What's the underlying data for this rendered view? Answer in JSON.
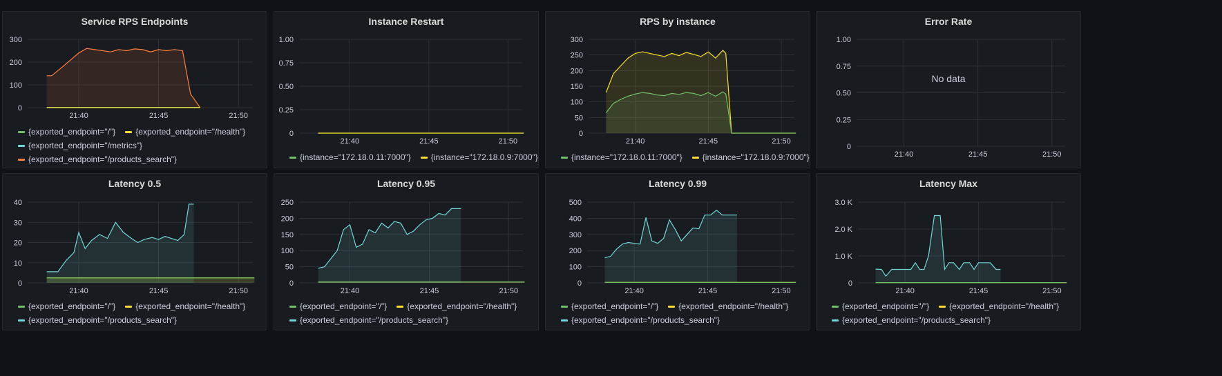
{
  "colors": {
    "green": "#73bf69",
    "yellow": "#fade2a",
    "cyan": "#73d6d6",
    "orange": "#ff7f3f",
    "grid": "#2c3038",
    "text": "#ccccdc",
    "panel_bg": "#181b1f"
  },
  "time_ticks": [
    "21:40",
    "21:45",
    "21:50"
  ],
  "panels": [
    {
      "title": "Service RPS Endpoints",
      "legend": [
        [
          {
            "label": "{exported_endpoint=\"/\"}",
            "color": "#73bf69"
          },
          {
            "label": "{exported_endpoint=\"/health\"}",
            "color": "#fade2a"
          }
        ],
        [
          {
            "label": "{exported_endpoint=\"/metrics\"}",
            "color": "#73d6d6"
          }
        ],
        [
          {
            "label": "{exported_endpoint=\"/products_search\"}",
            "color": "#ff7f3f"
          }
        ]
      ]
    },
    {
      "title": "Instance Restart",
      "legend": [
        [
          {
            "label": "{instance=\"172.18.0.11:7000\"}",
            "color": "#73bf69"
          },
          {
            "label": "{instance=\"172.18.0.9:7000\"}",
            "color": "#fade2a"
          }
        ]
      ]
    },
    {
      "title": "RPS by instance",
      "legend": [
        [
          {
            "label": "{instance=\"172.18.0.11:7000\"}",
            "color": "#73bf69"
          },
          {
            "label": "{instance=\"172.18.0.9:7000\"}",
            "color": "#fade2a"
          }
        ]
      ]
    },
    {
      "title": "Error Rate",
      "no_data": "No data",
      "legend": []
    },
    {
      "title": "Latency 0.5",
      "legend": [
        [
          {
            "label": "{exported_endpoint=\"/\"}",
            "color": "#73bf69"
          },
          {
            "label": "{exported_endpoint=\"/health\"}",
            "color": "#fade2a"
          }
        ],
        [
          {
            "label": "{exported_endpoint=\"/products_search\"}",
            "color": "#73d6d6"
          }
        ]
      ]
    },
    {
      "title": "Latency 0.95",
      "legend": [
        [
          {
            "label": "{exported_endpoint=\"/\"}",
            "color": "#73bf69"
          },
          {
            "label": "{exported_endpoint=\"/health\"}",
            "color": "#fade2a"
          }
        ],
        [
          {
            "label": "{exported_endpoint=\"/products_search\"}",
            "color": "#73d6d6"
          }
        ]
      ]
    },
    {
      "title": "Latency 0.99",
      "legend": [
        [
          {
            "label": "{exported_endpoint=\"/\"}",
            "color": "#73bf69"
          },
          {
            "label": "{exported_endpoint=\"/health\"}",
            "color": "#fade2a"
          }
        ],
        [
          {
            "label": "{exported_endpoint=\"/products_search\"}",
            "color": "#73d6d6"
          }
        ]
      ]
    },
    {
      "title": "Latency Max",
      "legend": [
        [
          {
            "label": "{exported_endpoint=\"/\"}",
            "color": "#73bf69"
          },
          {
            "label": "{exported_endpoint=\"/health\"}",
            "color": "#fade2a"
          }
        ],
        [
          {
            "label": "{exported_endpoint=\"/products_search\"}",
            "color": "#73d6d6"
          }
        ]
      ]
    }
  ],
  "chart_data": [
    {
      "type": "area",
      "title": "Service RPS Endpoints",
      "x_unit": "minutes",
      "xlim": [
        21.633,
        21.84
      ],
      "x_ticks": [
        "21:40",
        "21:45",
        "21:50"
      ],
      "ylim": [
        0,
        300
      ],
      "y_ticks": [
        "0",
        "100",
        "200",
        "300"
      ],
      "series": [
        {
          "name": "{exported_endpoint=\"/products_search\"}",
          "color": "#ff7f3f",
          "x": [
            "21:38",
            "21:38.3",
            "21:39",
            "21:39.5",
            "21:40",
            "21:40.5",
            "21:41",
            "21:41.5",
            "21:42",
            "21:42.5",
            "21:43",
            "21:43.5",
            "21:44",
            "21:44.5",
            "21:45",
            "21:45.5",
            "21:46",
            "21:46.5",
            "21:47",
            "21:47.6"
          ],
          "values": [
            140,
            140,
            180,
            210,
            240,
            260,
            255,
            250,
            245,
            255,
            250,
            258,
            255,
            245,
            255,
            250,
            255,
            250,
            60,
            0
          ]
        },
        {
          "name": "{exported_endpoint=\"/metrics\"}",
          "color": "#73d6d6",
          "x": [
            "21:38",
            "21:47.6"
          ],
          "values": [
            1,
            1
          ]
        },
        {
          "name": "{exported_endpoint=\"/\"}",
          "color": "#73bf69",
          "x": [
            "21:38",
            "21:47.6"
          ],
          "values": [
            0,
            0
          ]
        },
        {
          "name": "{exported_endpoint=\"/health\"}",
          "color": "#fade2a",
          "x": [
            "21:38",
            "21:47.6"
          ],
          "values": [
            0,
            0
          ]
        }
      ]
    },
    {
      "type": "line",
      "title": "Instance Restart",
      "ylim": [
        0,
        1
      ],
      "y_ticks": [
        "0",
        "0.25",
        "0.50",
        "0.75",
        "1.00"
      ],
      "x_ticks": [
        "21:40",
        "21:45",
        "21:50"
      ],
      "series": [
        {
          "name": "{instance=\"172.18.0.11:7000\"}",
          "color": "#73bf69",
          "x": [
            "21:38",
            "21:51"
          ],
          "values": [
            0,
            0
          ]
        },
        {
          "name": "{instance=\"172.18.0.9:7000\"}",
          "color": "#fade2a",
          "x": [
            "21:38",
            "21:51"
          ],
          "values": [
            0,
            0
          ]
        }
      ]
    },
    {
      "type": "area",
      "title": "RPS by instance",
      "ylim": [
        0,
        300
      ],
      "y_ticks": [
        "0",
        "50",
        "100",
        "150",
        "200",
        "250",
        "300"
      ],
      "x_ticks": [
        "21:40",
        "21:45",
        "21:50"
      ],
      "series": [
        {
          "name": "{instance=\"172.18.0.9:7000\"}",
          "color": "#fade2a",
          "x": [
            "21:38",
            "21:38.5",
            "21:39",
            "21:39.5",
            "21:40",
            "21:40.5",
            "21:41",
            "21:41.5",
            "21:42",
            "21:42.5",
            "21:43",
            "21:43.5",
            "21:44",
            "21:44.5",
            "21:45",
            "21:45.5",
            "21:46",
            "21:46.2",
            "21:46.6",
            "21:51"
          ],
          "values": [
            130,
            190,
            215,
            240,
            255,
            260,
            255,
            250,
            245,
            255,
            248,
            258,
            252,
            245,
            260,
            240,
            265,
            255,
            0,
            0
          ]
        },
        {
          "name": "{instance=\"172.18.0.11:7000\"}",
          "color": "#73bf69",
          "x": [
            "21:38",
            "21:38.5",
            "21:39",
            "21:39.5",
            "21:40",
            "21:40.5",
            "21:41",
            "21:41.5",
            "21:42",
            "21:42.5",
            "21:43",
            "21:43.5",
            "21:44",
            "21:44.5",
            "21:45",
            "21:45.5",
            "21:46",
            "21:46.2",
            "21:46.6",
            "21:51"
          ],
          "values": [
            65,
            95,
            108,
            118,
            125,
            130,
            127,
            122,
            120,
            127,
            124,
            130,
            127,
            120,
            130,
            118,
            132,
            125,
            0,
            0
          ]
        }
      ]
    },
    {
      "type": "line",
      "title": "Error Rate",
      "ylim": [
        0,
        1
      ],
      "y_ticks": [
        "0",
        "0.25",
        "0.50",
        "0.75",
        "1.00"
      ],
      "x_ticks": [
        "21:40",
        "21:45",
        "21:50"
      ],
      "series": []
    },
    {
      "type": "area",
      "title": "Latency 0.5",
      "ylim": [
        0,
        40
      ],
      "y_ticks": [
        "0",
        "10",
        "20",
        "30",
        "40"
      ],
      "x_ticks": [
        "21:40",
        "21:45",
        "21:50"
      ],
      "series": [
        {
          "name": "{exported_endpoint=\"/products_search\"}",
          "color": "#73d6d6",
          "x": [
            "21:38",
            "21:38.7",
            "21:39.2",
            "21:39.7",
            "21:40",
            "21:40.4",
            "21:40.8",
            "21:41.3",
            "21:41.8",
            "21:42.3",
            "21:42.8",
            "21:43.3",
            "21:43.7",
            "21:44.1",
            "21:44.6",
            "21:45",
            "21:45.4",
            "21:45.8",
            "21:46.2",
            "21:46.6",
            "21:46.9",
            "21:47.2"
          ],
          "values": [
            5.5,
            5.5,
            11,
            15,
            25,
            17,
            21,
            24,
            22,
            30,
            25,
            22,
            20,
            21.5,
            22.5,
            21.5,
            23,
            22,
            21,
            24,
            39,
            39
          ]
        },
        {
          "name": "{exported_endpoint=\"/health\"}",
          "color": "#fade2a",
          "x": [
            "21:38",
            "21:51"
          ],
          "values": [
            2.5,
            2.5
          ]
        },
        {
          "name": "{exported_endpoint=\"/\"}",
          "color": "#73bf69",
          "x": [
            "21:38",
            "21:51"
          ],
          "values": [
            2.5,
            2.5
          ]
        }
      ]
    },
    {
      "type": "area",
      "title": "Latency 0.95",
      "ylim": [
        0,
        250
      ],
      "y_ticks": [
        "0",
        "50",
        "100",
        "150",
        "200",
        "250"
      ],
      "x_ticks": [
        "21:40",
        "21:45",
        "21:50"
      ],
      "series": [
        {
          "name": "{exported_endpoint=\"/products_search\"}",
          "color": "#73d6d6",
          "x": [
            "21:38",
            "21:38.4",
            "21:38.8",
            "21:39.2",
            "21:39.6",
            "21:40",
            "21:40.4",
            "21:40.8",
            "21:41.2",
            "21:41.6",
            "21:42",
            "21:42.4",
            "21:42.8",
            "21:43.2",
            "21:43.6",
            "21:44",
            "21:44.4",
            "21:44.8",
            "21:45.2",
            "21:45.6",
            "21:46",
            "21:46.4",
            "21:46.8",
            "21:47"
          ],
          "values": [
            45,
            50,
            75,
            100,
            165,
            180,
            110,
            120,
            165,
            155,
            185,
            170,
            190,
            185,
            150,
            160,
            180,
            195,
            200,
            215,
            210,
            230,
            230,
            230
          ]
        },
        {
          "name": "{exported_endpoint=\"/health\"}",
          "color": "#fade2a",
          "x": [
            "21:38",
            "21:51"
          ],
          "values": [
            3,
            3
          ]
        },
        {
          "name": "{exported_endpoint=\"/\"}",
          "color": "#73bf69",
          "x": [
            "21:38",
            "21:51"
          ],
          "values": [
            3,
            3
          ]
        }
      ]
    },
    {
      "type": "area",
      "title": "Latency 0.99",
      "ylim": [
        0,
        500
      ],
      "y_ticks": [
        "0",
        "100",
        "200",
        "300",
        "400",
        "500"
      ],
      "x_ticks": [
        "21:40",
        "21:45",
        "21:50"
      ],
      "series": [
        {
          "name": "{exported_endpoint=\"/products_search\"}",
          "color": "#73d6d6",
          "x": [
            "21:38",
            "21:38.4",
            "21:38.8",
            "21:39.2",
            "21:39.6",
            "21:40",
            "21:40.4",
            "21:40.8",
            "21:41.2",
            "21:41.6",
            "21:42",
            "21:42.4",
            "21:42.8",
            "21:43.2",
            "21:43.6",
            "21:44",
            "21:44.4",
            "21:44.8",
            "21:45.2",
            "21:45.6",
            "21:46",
            "21:46.4",
            "21:46.8",
            "21:47"
          ],
          "values": [
            155,
            165,
            210,
            240,
            250,
            245,
            240,
            405,
            260,
            245,
            275,
            390,
            330,
            260,
            300,
            340,
            335,
            420,
            420,
            450,
            420,
            420,
            420,
            420
          ]
        },
        {
          "name": "{exported_endpoint=\"/health\"}",
          "color": "#fade2a",
          "x": [
            "21:38",
            "21:51"
          ],
          "values": [
            3,
            3
          ]
        },
        {
          "name": "{exported_endpoint=\"/\"}",
          "color": "#73bf69",
          "x": [
            "21:38",
            "21:51"
          ],
          "values": [
            3,
            3
          ]
        }
      ]
    },
    {
      "type": "area",
      "title": "Latency Max",
      "ylim": [
        0,
        3000
      ],
      "y_ticks": [
        "0",
        "1.0 K",
        "2.0 K",
        "3.0 K"
      ],
      "x_ticks": [
        "21:40",
        "21:45",
        "21:50"
      ],
      "series": [
        {
          "name": "{exported_endpoint=\"/products_search\"}",
          "color": "#73d6d6",
          "x": [
            "21:38",
            "21:38.4",
            "21:38.7",
            "21:39.1",
            "21:39.5",
            "21:40",
            "21:40.4",
            "21:40.7",
            "21:41",
            "21:41.3",
            "21:41.6",
            "21:42",
            "21:42.4",
            "21:42.7",
            "21:43",
            "21:43.3",
            "21:43.7",
            "21:44",
            "21:44.4",
            "21:44.7",
            "21:45",
            "21:45.4",
            "21:45.8",
            "21:46.2",
            "21:46.5"
          ],
          "values": [
            510,
            500,
            250,
            500,
            500,
            500,
            500,
            750,
            500,
            500,
            1000,
            2500,
            2500,
            500,
            750,
            750,
            500,
            750,
            750,
            500,
            750,
            750,
            750,
            500,
            500
          ]
        },
        {
          "name": "{exported_endpoint=\"/health\"}",
          "color": "#fade2a",
          "x": [
            "21:38",
            "21:51"
          ],
          "values": [
            10,
            10
          ]
        },
        {
          "name": "{exported_endpoint=\"/\"}",
          "color": "#73bf69",
          "x": [
            "21:38",
            "21:51"
          ],
          "values": [
            10,
            10
          ]
        }
      ]
    }
  ]
}
